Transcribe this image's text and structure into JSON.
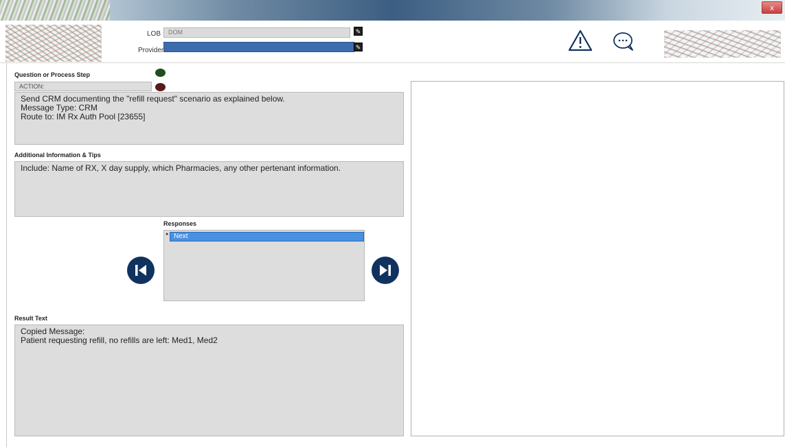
{
  "window": {
    "close_label": "x"
  },
  "header": {
    "lob_label": "LOB",
    "lob_value": "DOM",
    "provider_label": "Provider",
    "provider_value": "",
    "warning_icon": "warning-icon",
    "chat_icon": "chat-icon"
  },
  "question": {
    "label": "Question or Process Step",
    "action_label": "ACTION:",
    "lines": [
      "Send CRM  documenting the \"refill request\" scenario as explained below.",
      "Message Type: CRM",
      "Route to: IM Rx Auth Pool [23655]"
    ]
  },
  "additional": {
    "label": "Additional Information & Tips",
    "text": "Include: Name of RX, X day supply, which Pharmacies, any other pertenant information."
  },
  "responses": {
    "label": "Responses",
    "items": [
      "Next"
    ]
  },
  "result": {
    "label": "Result Text",
    "lines": [
      "Copied Message:",
      "Patient requesting refill, no refills are left: Med1, Med2"
    ]
  },
  "colors": {
    "accent": "#10325e",
    "selection": "#4a90e0",
    "status_green": "#1f4e1f",
    "status_red": "#5a1a1a"
  }
}
